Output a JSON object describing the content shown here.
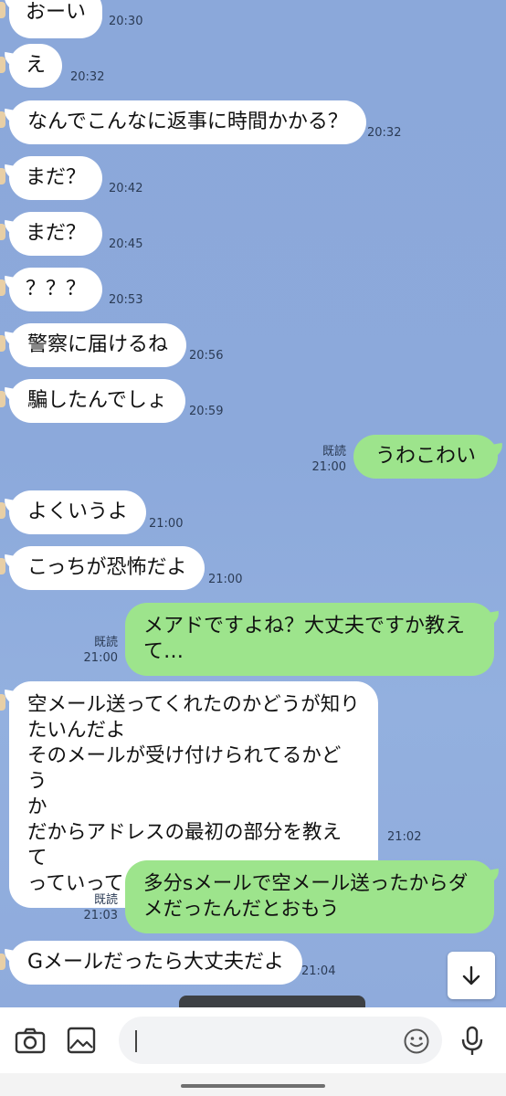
{
  "messages": [
    {
      "dir": "in",
      "text": "おーい",
      "time": "20:30"
    },
    {
      "dir": "in",
      "text": "え",
      "time": "20:32"
    },
    {
      "dir": "in",
      "text": "なんでこんなに返事に時間かかる？",
      "time": "20:32"
    },
    {
      "dir": "in",
      "text": "まだ？",
      "time": "20:42"
    },
    {
      "dir": "in",
      "text": "まだ？",
      "time": "20:45"
    },
    {
      "dir": "in",
      "text": "？？？",
      "time": "20:53"
    },
    {
      "dir": "in",
      "text": "警察に届けるね",
      "time": "20:56"
    },
    {
      "dir": "in",
      "text": "騙したんでしょ",
      "time": "20:59"
    },
    {
      "dir": "out",
      "text": "うわこわい",
      "read": "既読",
      "time": "21:00"
    },
    {
      "dir": "in",
      "text": "よくいうよ",
      "time": "21:00"
    },
    {
      "dir": "in",
      "text": "こっちが恐怖だよ",
      "time": "21:00"
    },
    {
      "dir": "out",
      "text": "メアドですよね？大丈夫ですか教え\nて…",
      "read": "既読",
      "time": "21:00"
    },
    {
      "dir": "in",
      "text": "空メール送ってくれたのかどうが知り\nたいんだよ\nそのメールが受け付けられてるかどう\nか\nだからアドレスの最初の部分を教えて\nっていってるのｎ",
      "time": "21:02"
    },
    {
      "dir": "out",
      "text": "多分sメールで空メール送ったからダ\nメだったんだとおもう",
      "read": "既読",
      "time": "21:03"
    },
    {
      "dir": "in",
      "text": "Gメールだったら大丈夫だよ",
      "time": "21:04"
    }
  ],
  "input_bar": {
    "camera_icon": "camera-icon",
    "image_icon": "image-icon",
    "emoji_icon": "emoji-icon",
    "mic_icon": "microphone-icon",
    "input_value": ""
  },
  "scroll_button_icon": "arrow-down-icon",
  "colors": {
    "background": "#8aa7d8",
    "incoming_bubble": "#ffffff",
    "outgoing_bubble": "#9de48c"
  }
}
